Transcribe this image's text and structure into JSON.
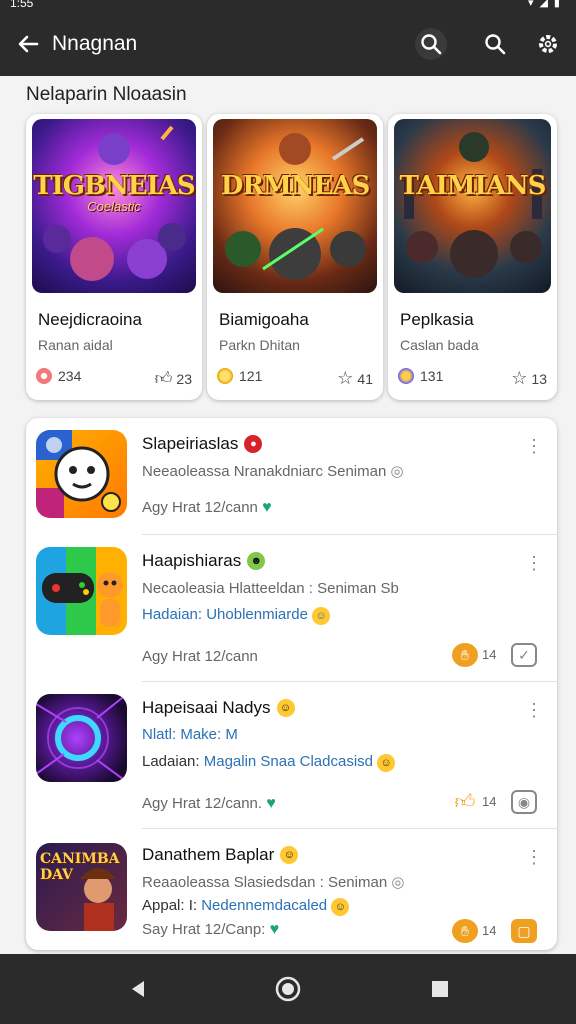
{
  "status": {
    "time": "1:55",
    "icons": "▾◢▮"
  },
  "appbar": {
    "title": "Nnagnan"
  },
  "section": {
    "title": "Nelaparin Nloaasin"
  },
  "cards": [
    {
      "art_title": "TIGBNEIAS",
      "art_sub": "Coelastic",
      "name": "Neejdicraoina",
      "sub": "Ranan aidal",
      "stat1": "234",
      "stat2": "23"
    },
    {
      "art_title": "DRMNEAS",
      "art_sub": "",
      "name": "Biamigoaha",
      "sub": "Parkn Dhitan",
      "stat1": "121",
      "stat2": "41"
    },
    {
      "art_title": "TAIMIANS",
      "art_sub": "",
      "name": "Peplkasia",
      "sub": "Caslan bada",
      "stat1": "131",
      "stat2": "13"
    }
  ],
  "list": [
    {
      "title": "Slapeiriaslas",
      "line1": "Neeaoleassa Nranakdniarc Seniman",
      "line2": "",
      "line3": "Agy Hrat 12/cann",
      "more": "⋮"
    },
    {
      "title": "Haapishiaras",
      "line1": "Necaoleasia Hlatteeldan : Seniman Sb",
      "line2": "Hadaian: Uhoblenmiarde",
      "line3": "Agy Hrat 12/cann",
      "more": "⋮",
      "icon_num": "14"
    },
    {
      "title": "Hapeisaai Nadys",
      "line1": "Nlatl: Make: M",
      "line2_prefix": "Ladaian:",
      "line2": "Magalin Snaa Cladcasisd",
      "line3": "Agy Hrat 12/cann.",
      "more": "⋮",
      "icon_num": "14"
    },
    {
      "title": "Danathem Baplar",
      "line1": "Reaaoleassa Slasiedsdan : Seniman",
      "line2_prefix": "Appal: I:",
      "line2": "Nedennemdacaled",
      "line3": "Say Hrat 12/Canp:",
      "more": "⋮",
      "icon_num": "14",
      "thumb_text": "CANIMBA DAV"
    }
  ],
  "colors": {
    "bar": "#2b2b2b",
    "accent_blue": "#2a72b5",
    "heart": "#1da37a",
    "orange": "#f0a020"
  }
}
